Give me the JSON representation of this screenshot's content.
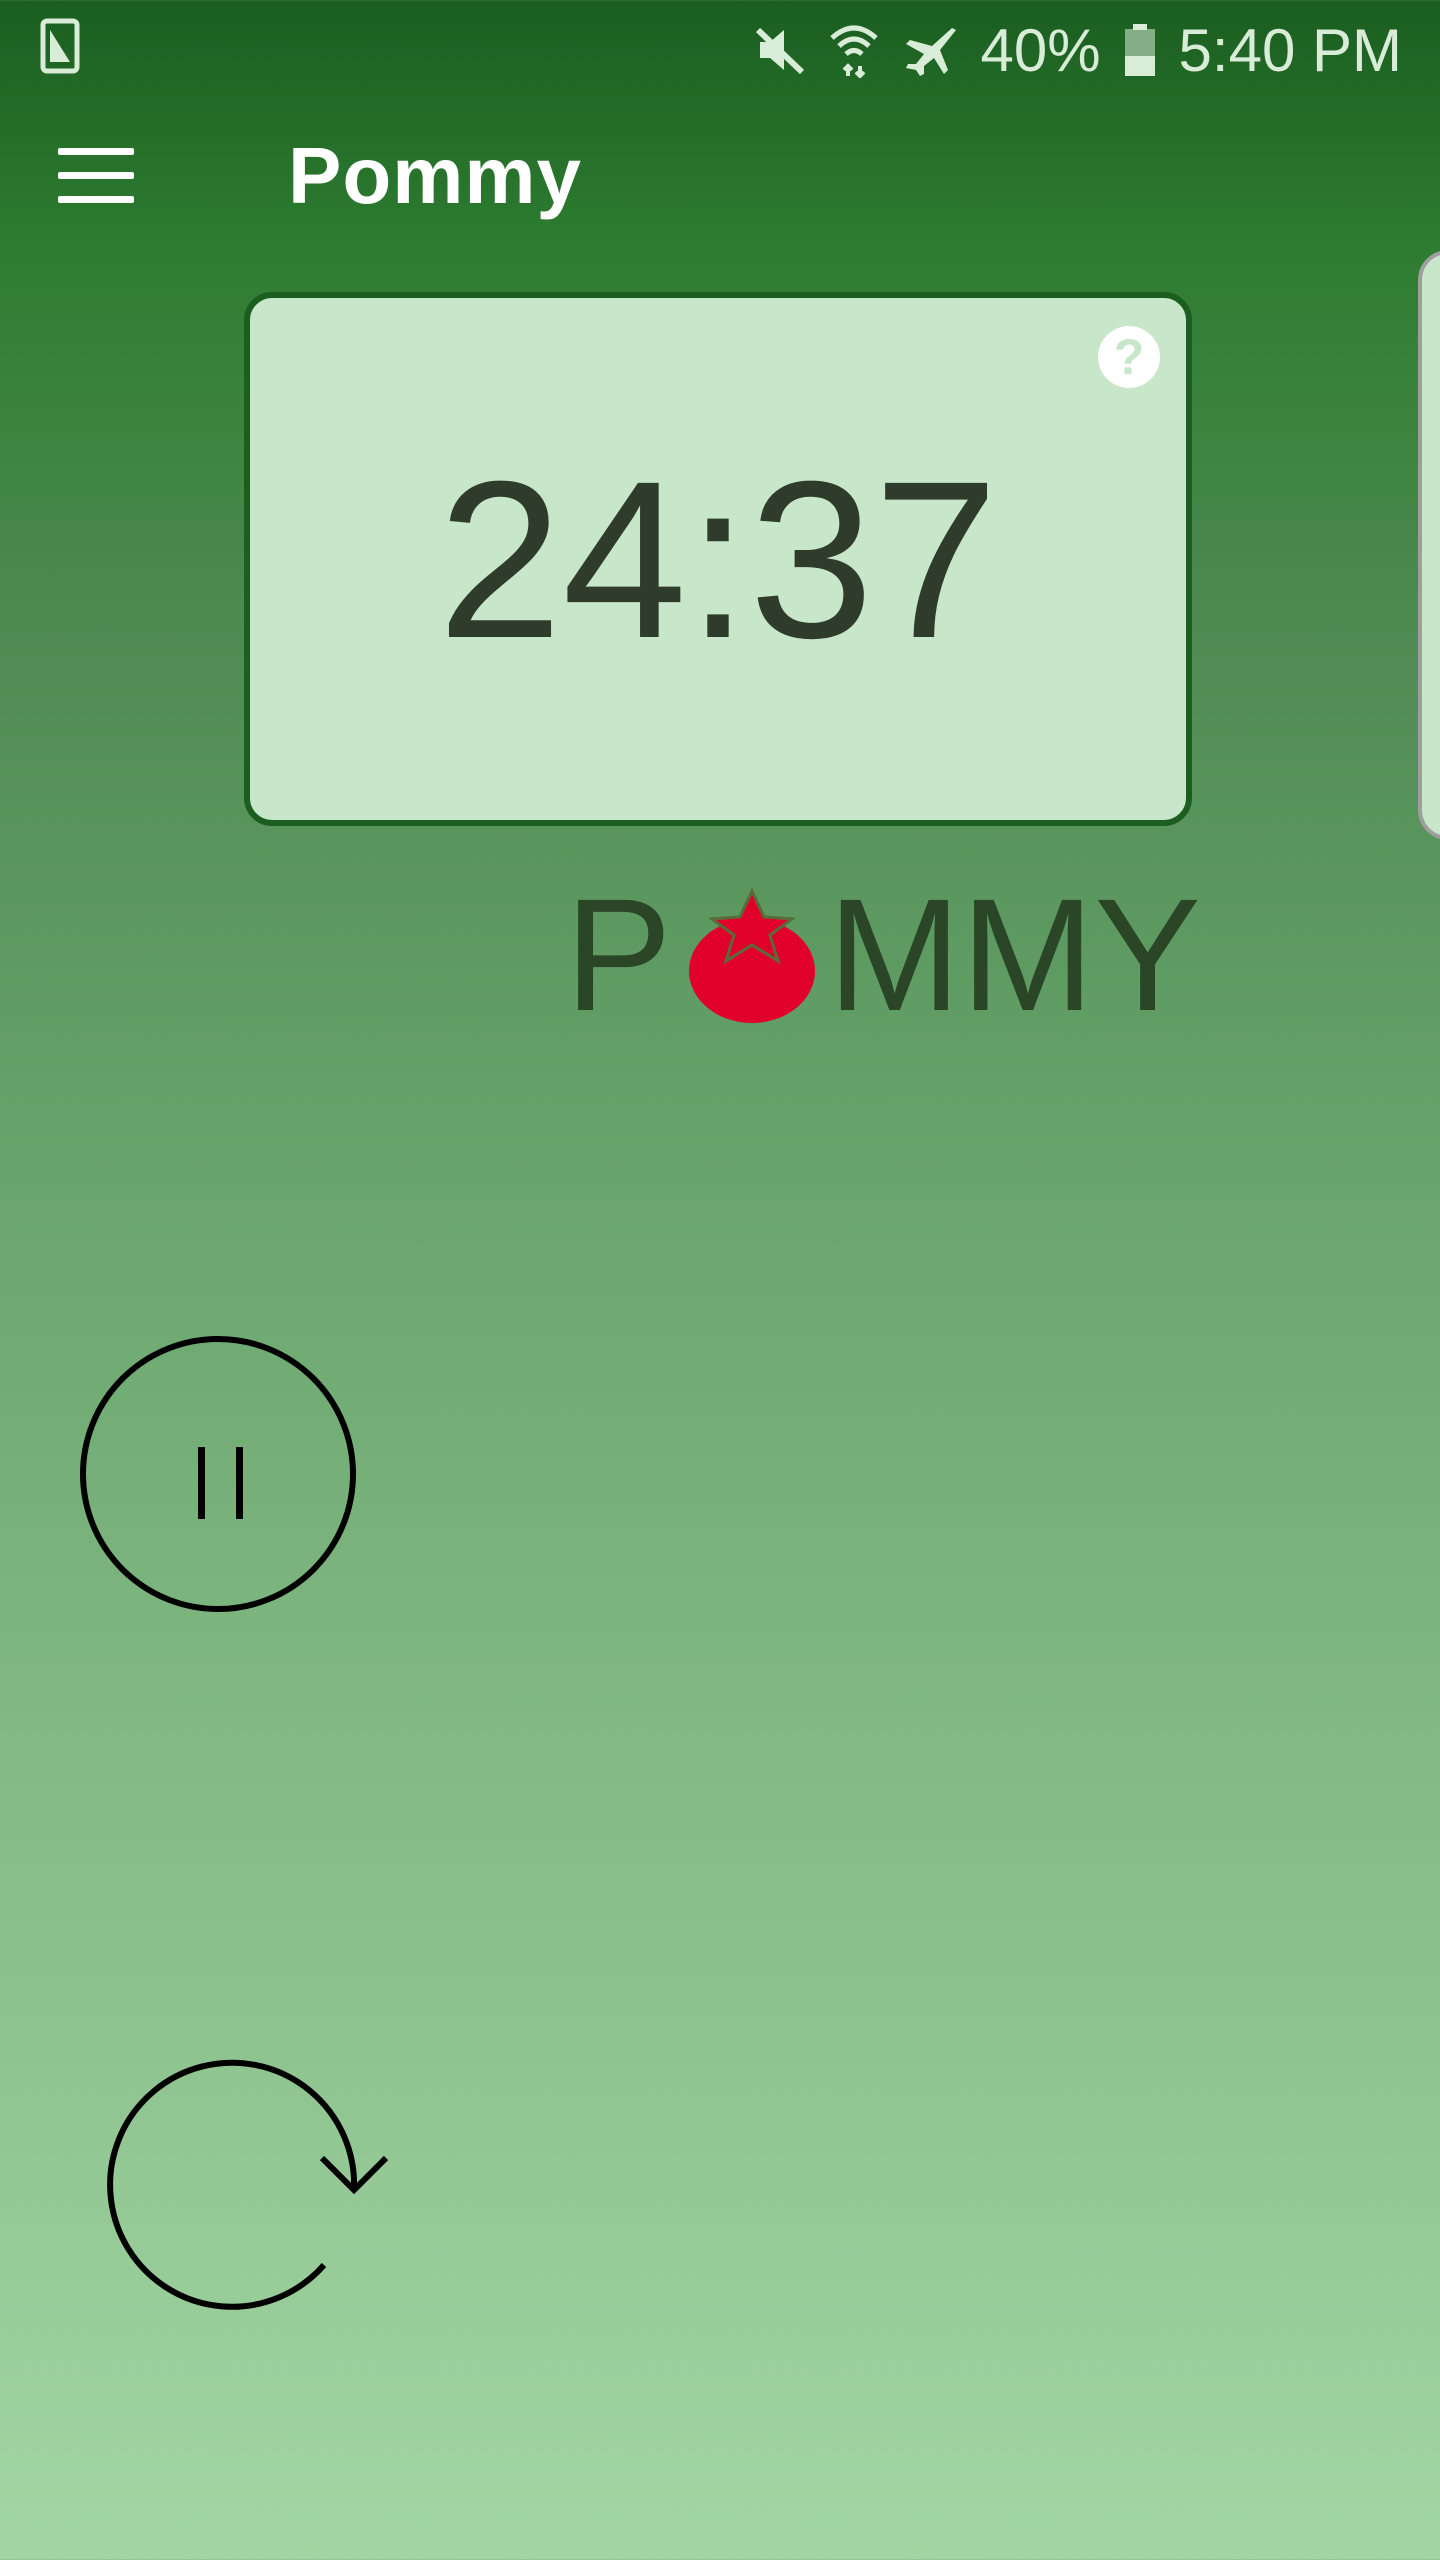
{
  "status_bar": {
    "battery_percent": "40%",
    "time": "5:40 PM",
    "battery_level": 0.4,
    "icons": [
      "screen-icon",
      "mute-icon",
      "wifi-icon",
      "airplane-icon",
      "battery-icon"
    ]
  },
  "app_bar": {
    "title": "Pommy",
    "menu_icon": "hamburger-menu-icon"
  },
  "timer": {
    "value": "24:37",
    "help_label": "?"
  },
  "logo": {
    "prefix": "P",
    "suffix": "MMY",
    "tomato_color": "#e0002a"
  },
  "controls": {
    "pause_icon": "pause-icon",
    "reset_icon": "reset-icon"
  },
  "colors": {
    "card_background": "#c8e6c9",
    "card_border": "#1b5e20",
    "accent_dark": "#1b5e20"
  }
}
